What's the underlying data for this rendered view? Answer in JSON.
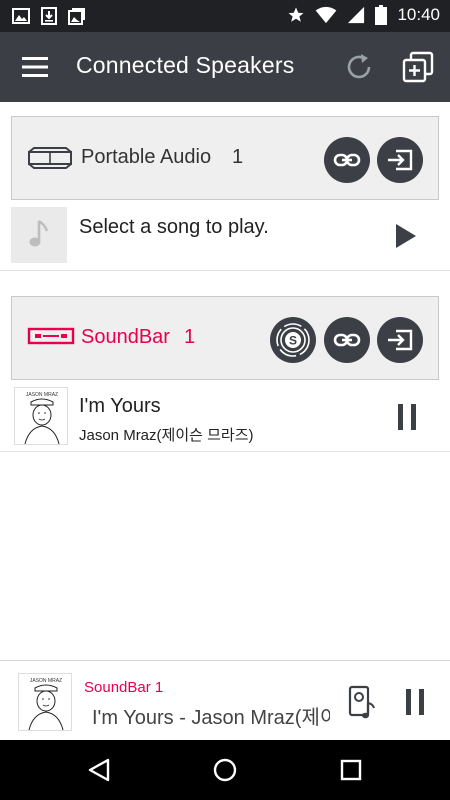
{
  "status_bar": {
    "time": "10:40",
    "icons": [
      "image-icon",
      "download-icon",
      "photo-stack-icon",
      "star-icon",
      "wifi-icon",
      "signal-icon",
      "battery-icon"
    ]
  },
  "app_bar": {
    "title": "Connected Speakers",
    "icons": [
      "menu-icon",
      "refresh-icon",
      "add-group-icon"
    ]
  },
  "groups": [
    {
      "name": "Portable Audio",
      "count": "1",
      "name_color": "#333333",
      "icon": "portable-speaker-icon",
      "buttons": [
        "link-icon",
        "input-source-icon"
      ],
      "now_playing": {
        "text": "Select a song to play.",
        "action": "play"
      }
    },
    {
      "name": "SoundBar",
      "count": "1",
      "name_color": "#e8004f",
      "icon": "soundbar-icon",
      "buttons": [
        "surround-s-icon",
        "link-icon",
        "input-source-icon"
      ],
      "now_playing": {
        "title": "I'm Yours",
        "artist": "Jason Mraz(제이슨 므라즈)",
        "action": "pause",
        "album_label": "JASON MRAZ"
      }
    }
  ],
  "mini_player": {
    "speaker": "SoundBar  1",
    "track": "I'm Yours - Jason Mraz(제이슨 므라즈)",
    "album_label": "JASON MRAZ"
  },
  "nav_bar": {
    "icons": [
      "back-icon",
      "home-icon",
      "recents-icon"
    ]
  },
  "colors": {
    "accent": "#e8004f",
    "appbar": "#3b3e45",
    "statusbar": "#1f2124",
    "button": "#3c3f46"
  }
}
